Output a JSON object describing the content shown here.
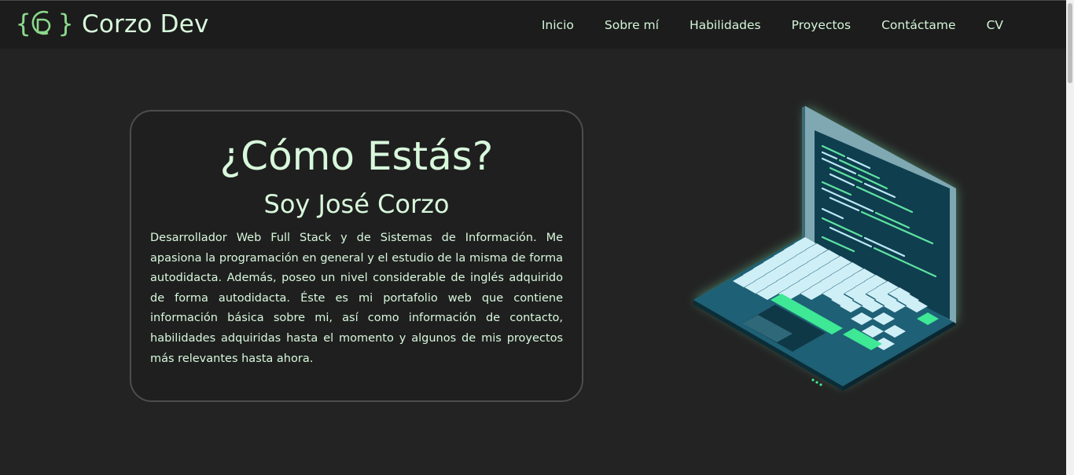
{
  "brand": {
    "logo_icon": "code-braces-cd-logo-icon",
    "name": "Corzo Dev"
  },
  "nav": {
    "links": [
      "Inicio",
      "Sobre mí",
      "Habilidades",
      "Proyectos",
      "Contáctame",
      "CV"
    ]
  },
  "hero": {
    "title": "¿Cómo Estás?",
    "subtitle": "Soy José Corzo",
    "description": "Desarrollador Web Full Stack y de Sistemas de Información. Me apasiona la programación en general y el estudio de la misma de forma autodidacta. Además, poseo un nivel considerable de inglés adquirido de forma autodidacta. Éste es mi portafolio web que contiene información básica sobre mi, así como información de contacto, habilidades adquiridas hasta el momento y algunos de mis proyectos más relevantes hasta ahora."
  },
  "illustration": {
    "icon": "laptop-code-icon"
  },
  "colors": {
    "background": "#232323",
    "navbar": "#1c1c1c",
    "text_accent": "#d8f8dc",
    "logo_green": "#8cd98c",
    "screen": "#0f3e4f",
    "keyboard_accent": "#3ee895"
  }
}
